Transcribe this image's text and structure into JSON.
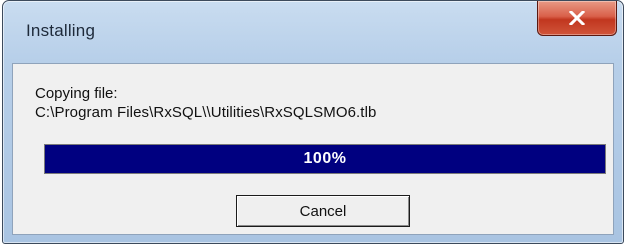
{
  "window": {
    "title": "Installing"
  },
  "titlebar": {
    "close_icon": "close-icon"
  },
  "status": {
    "line1": "Copying file:",
    "line2": "C:\\Program Files\\RxSQL\\\\Utilities\\RxSQLSMO6.tlb"
  },
  "progress": {
    "value": 100,
    "label": "100%",
    "fill_color": "#000080",
    "text_color": "#ffffff"
  },
  "buttons": {
    "cancel_label": "Cancel"
  },
  "colors": {
    "close_button": "#c9452d",
    "client_bg": "#f0f0f0",
    "frame": "#b7cfe9"
  }
}
